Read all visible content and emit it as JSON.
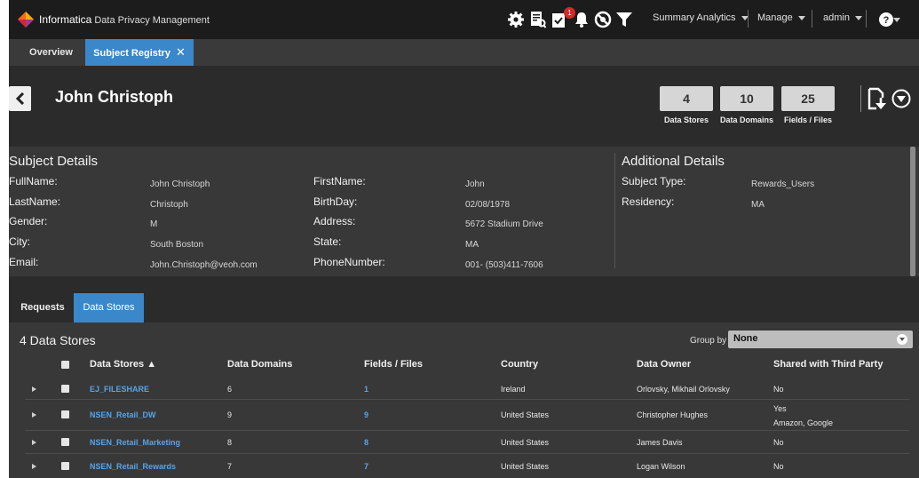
{
  "topbar": {
    "brand": "Informatica",
    "product": "Data Privacy Management",
    "notification_count": "1",
    "menus": [
      {
        "label": "Summary Analytics"
      },
      {
        "label": "Manage"
      },
      {
        "label": "admin"
      }
    ]
  },
  "tabs": [
    {
      "label": "Overview"
    },
    {
      "label": "Subject Registry"
    }
  ],
  "header": {
    "title": "John Christoph",
    "stats": [
      {
        "value": "4",
        "label": "Data Stores"
      },
      {
        "value": "10",
        "label": "Data Domains"
      },
      {
        "value": "25",
        "label": "Fields / Files"
      }
    ]
  },
  "subject_details": {
    "title": "Subject Details",
    "left": [
      {
        "label": "FullName:",
        "value": "John Christoph"
      },
      {
        "label": "LastName:",
        "value": "Christoph"
      },
      {
        "label": "Gender:",
        "value": "M"
      },
      {
        "label": "City:",
        "value": "South Boston"
      },
      {
        "label": "Email:",
        "value": "John.Christoph@veoh.com"
      }
    ],
    "right": [
      {
        "label": "FirstName:",
        "value": "John"
      },
      {
        "label": "BirthDay:",
        "value": "02/08/1978"
      },
      {
        "label": "Address:",
        "value": "5672 Stadium Drive"
      },
      {
        "label": "State:",
        "value": "MA"
      },
      {
        "label": "PhoneNumber:",
        "value": "001- (503)411-7606"
      }
    ]
  },
  "additional_details": {
    "title": "Additional Details",
    "fields": [
      {
        "label": "Subject Type:",
        "value": "Rewards_Users"
      },
      {
        "label": "Residency:",
        "value": "MA"
      }
    ]
  },
  "lower_tabs": [
    {
      "label": "Requests"
    },
    {
      "label": "Data Stores"
    }
  ],
  "data_stores": {
    "count_label": "4 Data Stores",
    "group_by_label": "Group by",
    "group_by_value": "None",
    "columns": [
      "Data Stores ▲",
      "Data Domains",
      "Fields / Files",
      "Country",
      "Data Owner",
      "Shared with Third Party"
    ],
    "rows": [
      {
        "name": "EJ_FILESHARE",
        "domains": "6",
        "fields": "1",
        "country": "Ireland",
        "owner": "Orlovsky, Mikhail Orlovsky",
        "shared": "No",
        "shared_detail": ""
      },
      {
        "name": "NSEN_Retail_DW",
        "domains": "9",
        "fields": "9",
        "country": "United States",
        "owner": "Christopher Hughes",
        "shared": "Yes",
        "shared_detail": "Amazon, Google"
      },
      {
        "name": "NSEN_Retail_Marketing",
        "domains": "8",
        "fields": "8",
        "country": "United States",
        "owner": "James Davis",
        "shared": "No",
        "shared_detail": ""
      },
      {
        "name": "NSEN_Retail_Rewards",
        "domains": "7",
        "fields": "7",
        "country": "United States",
        "owner": "Logan Wilson",
        "shared": "No",
        "shared_detail": ""
      }
    ]
  },
  "colors": {
    "accent": "#3a87c9",
    "link": "#57a4e6",
    "badge": "#d8262b"
  },
  "icons": [
    "informatica-logo-icon",
    "settings-gear-icon",
    "report-icon",
    "tasks-icon",
    "bell-icon",
    "support-icon",
    "filter-icon",
    "help-icon",
    "back-arrow-icon",
    "download-icon",
    "expand-circle-icon"
  ]
}
